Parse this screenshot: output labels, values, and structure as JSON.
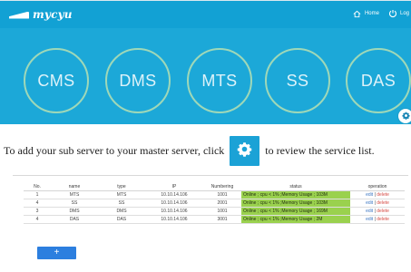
{
  "app": {
    "brand_name": "mycyu"
  },
  "nav": {
    "home_label": "Home",
    "logout_label": "Log"
  },
  "services": [
    {
      "label": "CMS"
    },
    {
      "label": "DMS"
    },
    {
      "label": "MTS"
    },
    {
      "label": "SS"
    },
    {
      "label": "DAS"
    }
  ],
  "instruction": {
    "before": "To add your sub server to your master server, click",
    "after": "to review the service list."
  },
  "table": {
    "headers": [
      "No.",
      "name",
      "type",
      "IP",
      "Numbering",
      "status",
      "operation"
    ],
    "rows": [
      {
        "no": "1",
        "name": "MTS",
        "type": "MTS",
        "ip": "10.10.14.106",
        "numbering": "1001",
        "status": "Online ; cpu < 1% ;Memory Usage ; 103M",
        "edit": "edit",
        "delete": "delete"
      },
      {
        "no": "4",
        "name": "SS",
        "type": "SS",
        "ip": "10.10.14.106",
        "numbering": "2001",
        "status": "Online ; cpu < 1% ;Memory Usage ; 103M",
        "edit": "edit",
        "delete": "delete"
      },
      {
        "no": "3",
        "name": "DMS",
        "type": "DMS",
        "ip": "10.10.14.106",
        "numbering": "1001",
        "status": "Online ; cpu < 1% ;Memory Usage ; 169M",
        "edit": "edit",
        "delete": "delete"
      },
      {
        "no": "4",
        "name": "DAS",
        "type": "DAS",
        "ip": "10.10.14.106",
        "numbering": "3001",
        "status": "Online ; cpu < 1% ;Memory Usage ; 2M",
        "edit": "edit",
        "delete": "delete"
      }
    ]
  },
  "actions": {
    "add_label": "+"
  },
  "colors": {
    "top_background": "#1ca8d8",
    "circle_border": "#9fd8b8",
    "status_background": "#9ad14e",
    "button_background": "#2c7fdf"
  },
  "icons": {
    "home": "home-icon",
    "logout": "power-icon",
    "settings": "gear-icon",
    "brand": "logo-icon"
  }
}
